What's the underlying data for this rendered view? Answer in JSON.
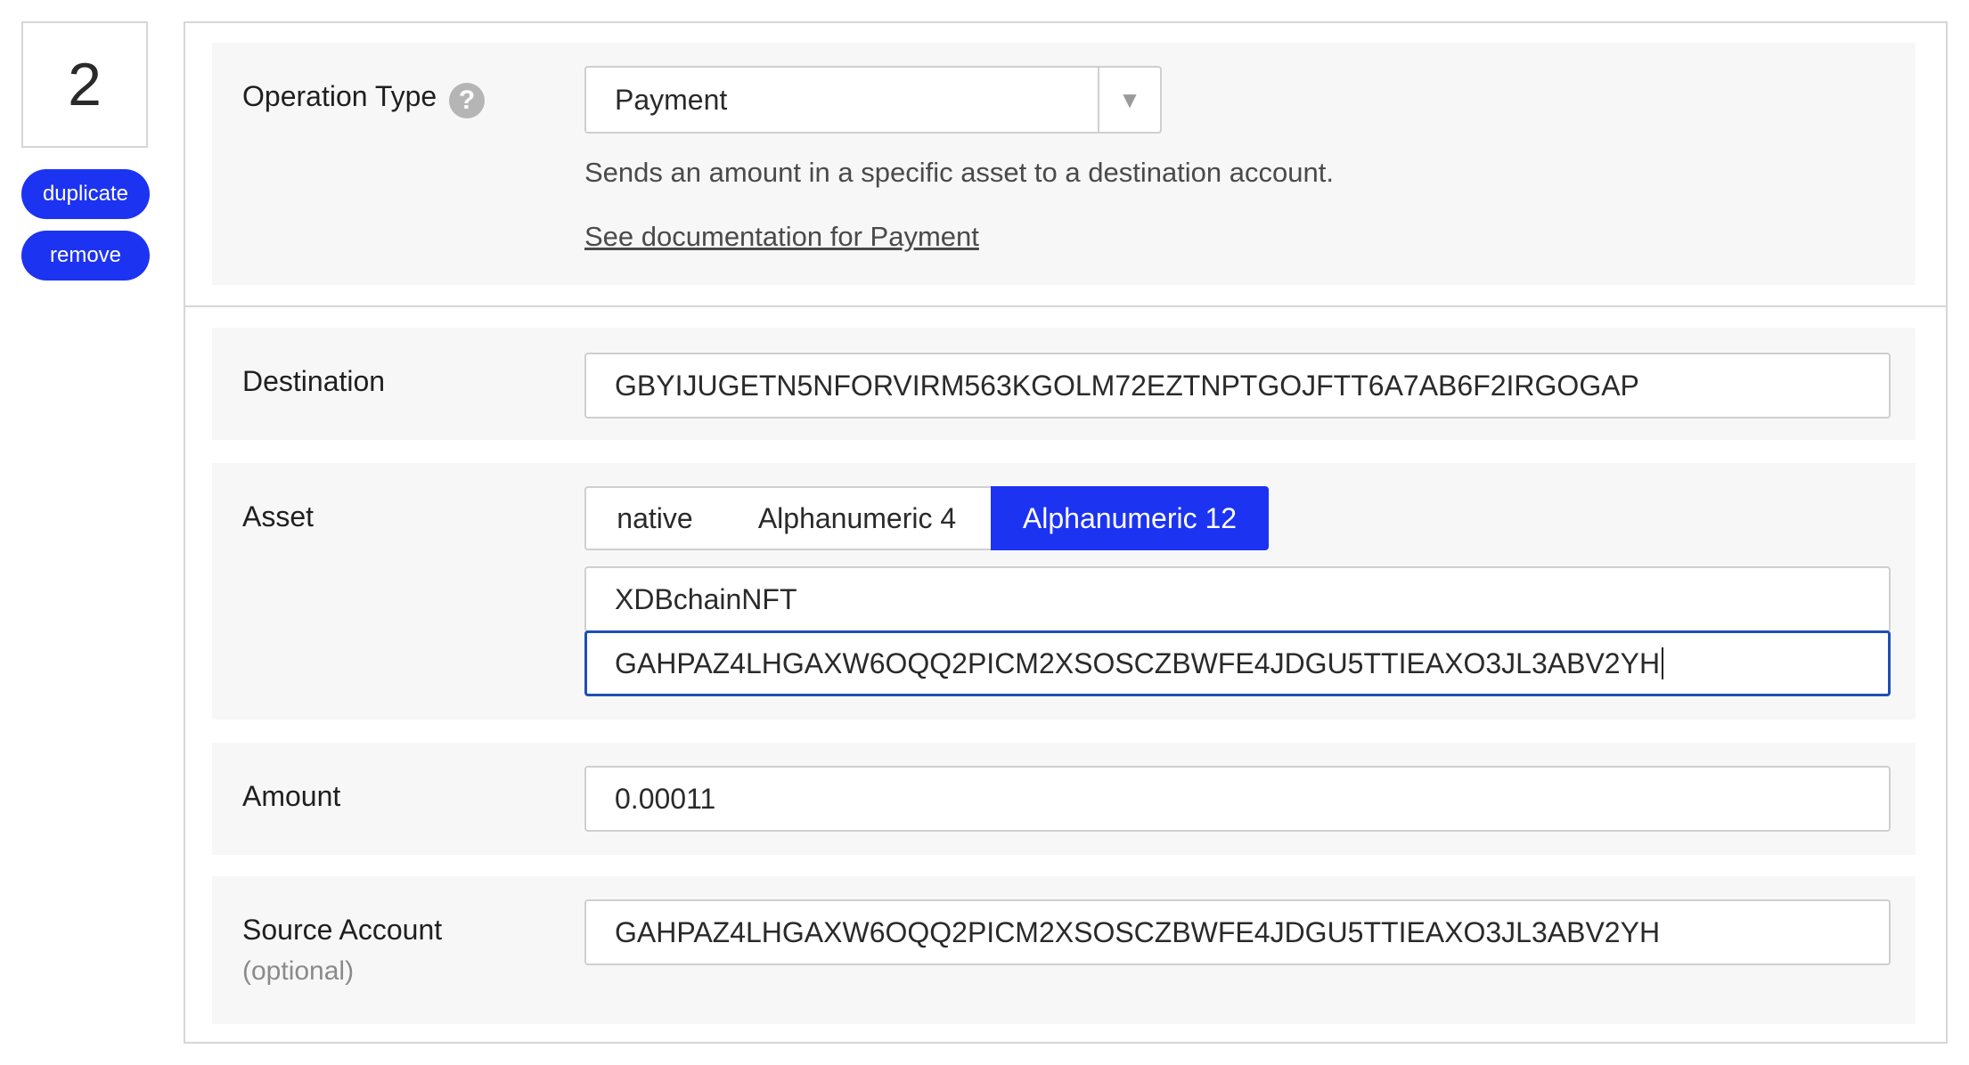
{
  "operation": {
    "number": "2",
    "duplicate_label": "duplicate",
    "remove_label": "remove"
  },
  "operation_type": {
    "label": "Operation Type",
    "help_symbol": "?",
    "selected": "Payment",
    "arrow": "▼",
    "description": "Sends an amount in a specific asset to a destination account.",
    "doc_link": "See documentation for Payment"
  },
  "destination": {
    "label": "Destination",
    "value": "GBYIJUGETN5NFORVIRM563KGOLM72EZTNPTGOJFTT6A7AB6F2IRGOGAP"
  },
  "asset": {
    "label": "Asset",
    "options": [
      "native",
      "Alphanumeric 4",
      "Alphanumeric 12"
    ],
    "selected": "Alphanumeric 12",
    "code_value": "XDBchainNFT",
    "issuer_value": "GAHPAZ4LHGAXW6OQQ2PICM2XSOSCZBWFE4JDGU5TTIEAXO3JL3ABV2YH"
  },
  "amount": {
    "label": "Amount",
    "value": "0.00011"
  },
  "source_account": {
    "label": "Source Account",
    "optional_label": "(optional)",
    "value": "GAHPAZ4LHGAXW6OQQ2PICM2XSOSCZBWFE4JDGU5TTIEAXO3JL3ABV2YH"
  },
  "colors": {
    "accent": "#1c33f2",
    "focus_border": "#1d4fb6",
    "row_background": "#f7f7f7",
    "border": "#cfcfcf"
  }
}
